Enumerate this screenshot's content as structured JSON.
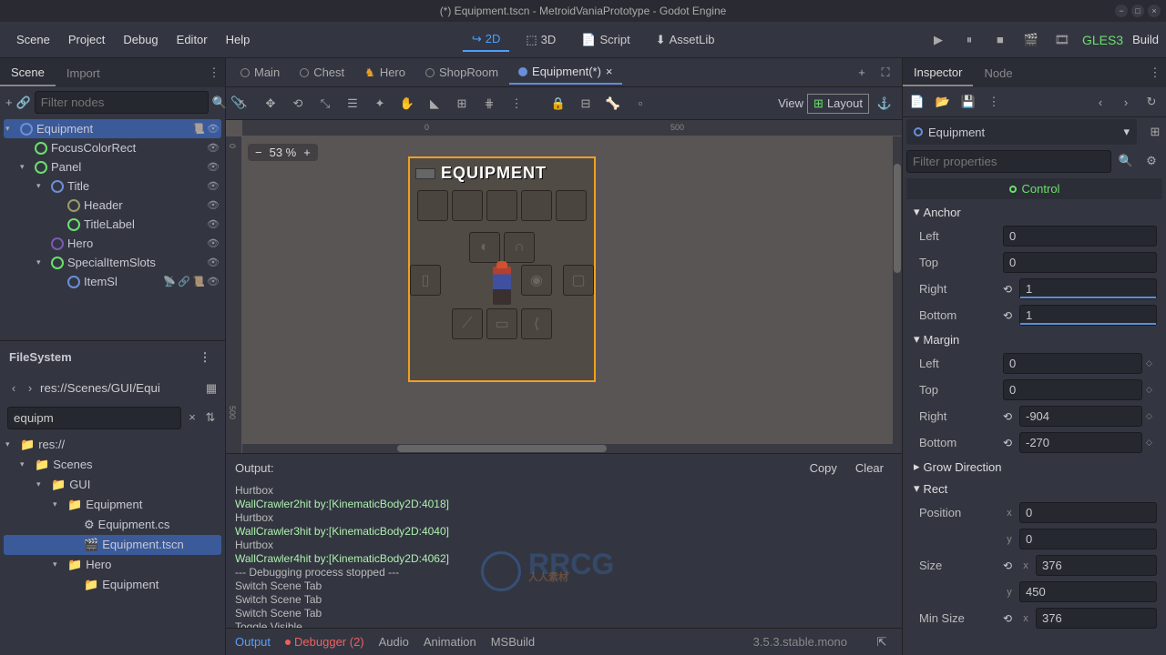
{
  "title": "(*) Equipment.tscn - MetroidVaniaPrototype - Godot Engine",
  "menubar": [
    "Scene",
    "Project",
    "Debug",
    "Editor",
    "Help"
  ],
  "modes": {
    "d2": "2D",
    "d3": "3D",
    "script": "Script",
    "assetlib": "AssetLib"
  },
  "gles": "GLES3",
  "build": "Build",
  "left_tabs": {
    "scene": "Scene",
    "import": "Import"
  },
  "filter_nodes_ph": "Filter nodes",
  "scene_tree": [
    {
      "name": "Equipment",
      "icon": "#6a8fd8",
      "sel": true,
      "ind": 0,
      "exp": "▾",
      "script": true
    },
    {
      "name": "FocusColorRect",
      "icon": "#6be06b",
      "ind": 1
    },
    {
      "name": "Panel",
      "icon": "#6be06b",
      "ind": 1,
      "exp": "▾"
    },
    {
      "name": "Title",
      "icon": "#6a8fd8",
      "ind": 2,
      "exp": "▾"
    },
    {
      "name": "Header",
      "icon": "#9a9a6a",
      "ind": 3
    },
    {
      "name": "TitleLabel",
      "icon": "#6be06b",
      "ind": 3
    },
    {
      "name": "Hero",
      "icon": "#7a5aaf",
      "ind": 2
    },
    {
      "name": "SpecialItemSlots",
      "icon": "#6be06b",
      "ind": 2,
      "exp": "▾"
    },
    {
      "name": "ItemSl",
      "icon": "#6a8fd8",
      "ind": 3,
      "extra": true
    }
  ],
  "filesystem": {
    "header": "FileSystem",
    "path": "res://Scenes/GUI/Equi",
    "search": "equipm",
    "tree": [
      {
        "name": "res://",
        "ind": 0,
        "exp": "▾",
        "t": "folder"
      },
      {
        "name": "Scenes",
        "ind": 1,
        "exp": "▾",
        "t": "folder"
      },
      {
        "name": "GUI",
        "ind": 2,
        "exp": "▾",
        "t": "folder"
      },
      {
        "name": "Equipment",
        "ind": 3,
        "exp": "▾",
        "t": "folder"
      },
      {
        "name": "Equipment.cs",
        "ind": 4,
        "t": "cs"
      },
      {
        "name": "Equipment.tscn",
        "ind": 4,
        "t": "tscn",
        "sel": true
      },
      {
        "name": "Hero",
        "ind": 3,
        "exp": "▾",
        "t": "folder"
      },
      {
        "name": "Equipment",
        "ind": 4,
        "t": "folder"
      }
    ]
  },
  "doc_tabs": [
    {
      "name": "Main"
    },
    {
      "name": "Chest"
    },
    {
      "name": "Hero",
      "hero": true
    },
    {
      "name": "ShopRoom"
    },
    {
      "name": "Equipment(*)",
      "active": true,
      "close": true
    }
  ],
  "canvas": {
    "zoom": "53 %",
    "title": "EQUIPMENT",
    "ruler_h": [
      {
        "p": 200,
        "v": "0"
      },
      {
        "p": 470,
        "v": "500"
      }
    ],
    "ruler_v": [
      {
        "p": 8,
        "v": "0"
      },
      {
        "p": 296,
        "v": "500"
      }
    ]
  },
  "toolbar2": {
    "view": "View",
    "layout": "Layout"
  },
  "output": {
    "label": "Output:",
    "copy": "Copy",
    "clear": "Clear",
    "lines": [
      {
        "t": "Hurtbox"
      },
      {
        "t": "WallCrawler2hit by:[KinematicBody2D:4018]",
        "g": true
      },
      {
        "t": "Hurtbox"
      },
      {
        "t": "WallCrawler3hit by:[KinematicBody2D:4040]",
        "g": true
      },
      {
        "t": "Hurtbox"
      },
      {
        "t": "WallCrawler4hit by:[KinematicBody2D:4062]",
        "g": true
      },
      {
        "t": "--- Debugging process stopped ---"
      },
      {
        "t": "Switch Scene Tab"
      },
      {
        "t": "Switch Scene Tab"
      },
      {
        "t": "Switch Scene Tab"
      },
      {
        "t": "Toggle Visible"
      }
    ]
  },
  "bottom_tabs": {
    "output": "Output",
    "debugger": "Debugger (2)",
    "audio": "Audio",
    "animation": "Animation",
    "msbuild": "MSBuild",
    "version": "3.5.3.stable.mono"
  },
  "right_tabs": {
    "inspector": "Inspector",
    "node": "Node"
  },
  "inspector": {
    "obj": "Equipment",
    "filter_ph": "Filter properties",
    "class": "Control",
    "sections": [
      {
        "name": "Anchor",
        "open": true,
        "rows": [
          {
            "k": "Left",
            "v": "0",
            "bar": 0
          },
          {
            "k": "Top",
            "v": "0",
            "bar": 0
          },
          {
            "k": "Right",
            "v": "1",
            "bar": 100,
            "reset": true
          },
          {
            "k": "Bottom",
            "v": "1",
            "bar": 100,
            "reset": true
          }
        ]
      },
      {
        "name": "Margin",
        "open": true,
        "rows": [
          {
            "k": "Left",
            "v": "0",
            "spin": true
          },
          {
            "k": "Top",
            "v": "0",
            "spin": true
          },
          {
            "k": "Right",
            "v": "-904",
            "reset": true,
            "spin": true
          },
          {
            "k": "Bottom",
            "v": "-270",
            "reset": true,
            "spin": true
          }
        ]
      },
      {
        "name": "Grow Direction",
        "open": false
      },
      {
        "name": "Rect",
        "open": true,
        "rows": [
          {
            "k": "Position",
            "axis": "x",
            "v": "0"
          },
          {
            "k": "",
            "axis": "y",
            "v": "0"
          },
          {
            "k": "Size",
            "axis": "x",
            "v": "376",
            "reset": true
          },
          {
            "k": "",
            "axis": "y",
            "v": "450"
          },
          {
            "k": "Min Size",
            "axis": "x",
            "v": "376",
            "reset": true
          }
        ]
      }
    ]
  }
}
